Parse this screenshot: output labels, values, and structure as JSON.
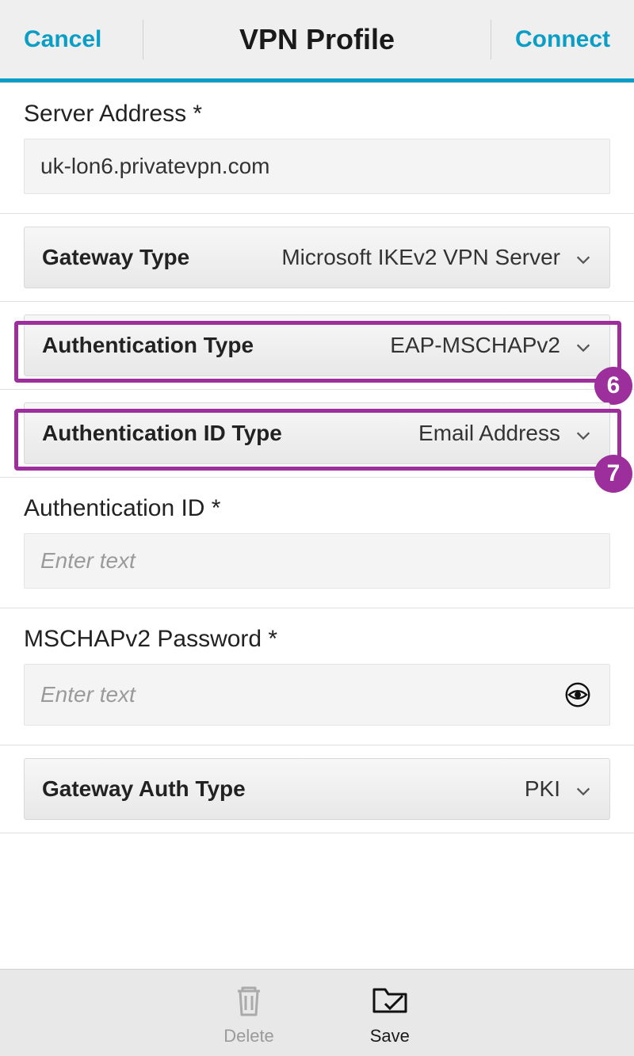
{
  "header": {
    "cancel": "Cancel",
    "title": "VPN Profile",
    "connect": "Connect"
  },
  "fields": {
    "server_address": {
      "label": "Server Address *",
      "value": "uk-lon6.privatevpn.com"
    },
    "gateway_type": {
      "label": "Gateway Type",
      "value": "Microsoft IKEv2 VPN Server"
    },
    "auth_type": {
      "label": "Authentication Type",
      "value": "EAP-MSCHAPv2"
    },
    "auth_id_type": {
      "label": "Authentication ID Type",
      "value": "Email Address"
    },
    "auth_id": {
      "label": "Authentication ID *",
      "placeholder": "Enter text"
    },
    "mschap_pw": {
      "label": "MSCHAPv2 Password *",
      "placeholder": "Enter text"
    },
    "gateway_auth_type": {
      "label": "Gateway Auth Type",
      "value": "PKI"
    }
  },
  "callouts": {
    "auth_type_badge": "6",
    "auth_id_type_badge": "7"
  },
  "toolbar": {
    "delete": "Delete",
    "save": "Save"
  },
  "colors": {
    "accent": "#0a9ec7",
    "highlight": "#9c2f9c"
  }
}
